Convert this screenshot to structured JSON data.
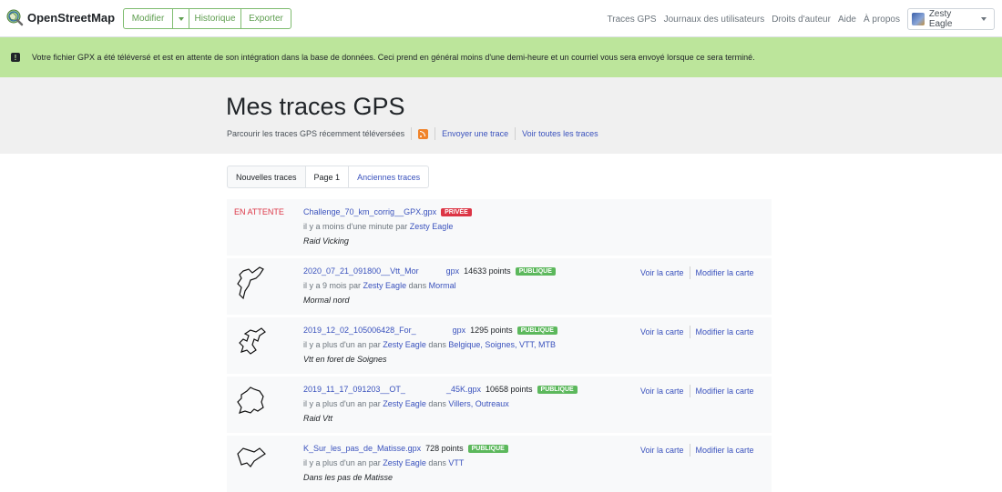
{
  "topbar": {
    "logo_text": "OpenStreetMap",
    "edit_buttons": [
      "Modifier",
      "Historique",
      "Exporter"
    ],
    "nav_links": [
      "Traces GPS",
      "Journaux des utilisateurs",
      "Droits d'auteur",
      "Aide",
      "À propos"
    ],
    "user_name": "Zesty Eagle"
  },
  "flash": {
    "message": "Votre fichier GPX a été téléversé et est en attente de son intégration dans la base de données. Ceci prend en général moins d'une demi-heure et un courriel vous sera envoyé lorsque ce sera terminé."
  },
  "header": {
    "title": "Mes traces GPS",
    "browse_text": "Parcourir les traces GPS récemment téléversées",
    "upload_link": "Envoyer une trace",
    "all_link": "Voir toutes les traces"
  },
  "pagination": [
    "Nouvelles traces",
    "Page 1",
    "Anciennes traces"
  ],
  "traces": [
    {
      "status": "EN ATTENTE",
      "name": "Challenge_70_km_corrig__GPX.gpx",
      "points": "",
      "badge": "PRIVÉE",
      "time_prefix": "il y a moins d'une minute par",
      "user": "Zesty Eagle",
      "tags_prefix": "",
      "tags": "",
      "description": "Raid Vicking",
      "view_link": "",
      "edit_link": ""
    },
    {
      "status": "",
      "name": "2020_07_21_091800__Vtt_Mor            gpx",
      "points": "14633 points",
      "badge": "PUBLIQUE",
      "time_prefix": "il y a 9 mois par",
      "user": "Zesty Eagle",
      "tags_prefix": "dans",
      "tags": "Mormal",
      "description": "Mormal nord",
      "view_link": "Voir la carte",
      "edit_link": "Modifier la carte"
    },
    {
      "status": "",
      "name": "2019_12_02_105006428_For_                gpx",
      "points": "1295 points",
      "badge": "PUBLIQUE",
      "time_prefix": "il y a plus d'un an par",
      "user": "Zesty Eagle",
      "tags_prefix": "dans",
      "tags": "Belgique, Soignes, VTT, MTB",
      "description": "Vtt en foret de Soignes",
      "view_link": "Voir la carte",
      "edit_link": "Modifier la carte"
    },
    {
      "status": "",
      "name": "2019_11_17_091203__OT_                  _45K.gpx",
      "points": "10658 points",
      "badge": "PUBLIQUE",
      "time_prefix": "il y a plus d'un an par",
      "user": "Zesty Eagle",
      "tags_prefix": "dans",
      "tags": "Villers, Outreaux",
      "description": "Raid Vtt",
      "view_link": "Voir la carte",
      "edit_link": "Modifier la carte"
    },
    {
      "status": "",
      "name": "K_Sur_les_pas_de_Matisse.gpx",
      "points": "728 points",
      "badge": "PUBLIQUE",
      "time_prefix": "il y a plus d'un an par",
      "user": "Zesty Eagle",
      "tags_prefix": "dans",
      "tags": "VTT",
      "description": "Dans les pas de Matisse",
      "view_link": "Voir la carte",
      "edit_link": "Modifier la carte"
    }
  ],
  "colors": {
    "brand_green": "#7ebc6f",
    "flash_green": "#bce59b",
    "link_blue": "#3a52bd",
    "badge_public": "#5cb85c",
    "badge_private": "#dc3545"
  },
  "icons": [
    "osm-logo-icon",
    "dropdown-caret-icon",
    "user-avatar-icon",
    "notice-icon",
    "rss-icon",
    "track-thumbnail-icon"
  ]
}
